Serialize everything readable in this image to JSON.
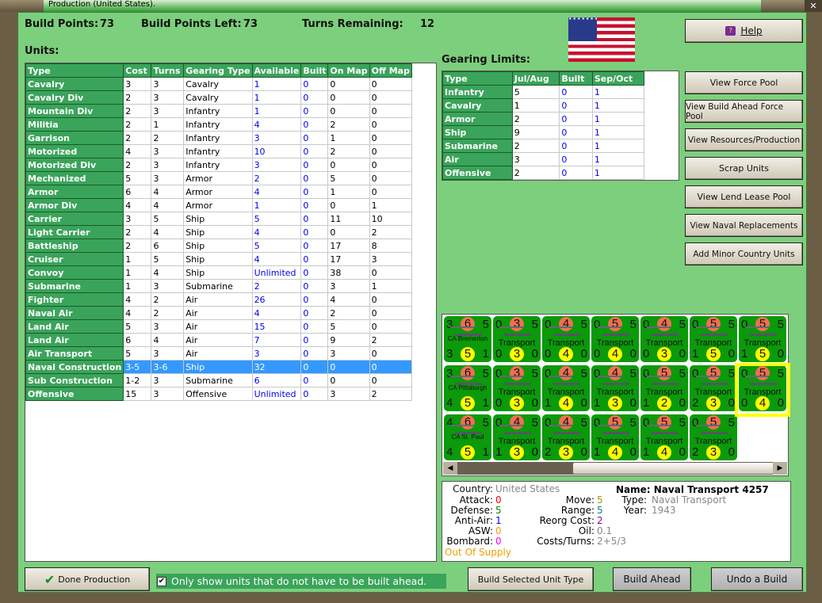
{
  "window": {
    "title": "Production (United States)."
  },
  "header": {
    "build_points_label": "Build Points:",
    "build_points": "73",
    "build_points_left_label": "Build Points Left:",
    "build_points_left": "73",
    "turns_remaining_label": "Turns Remaining:",
    "turns_remaining": "12"
  },
  "units": {
    "label": "Units:",
    "columns": [
      "Type",
      "Cost",
      "Turns",
      "Gearing Type",
      "Available",
      "Built",
      "On Map",
      "Off Map"
    ],
    "rows": [
      [
        "Cavalry",
        "3",
        "3",
        "Cavalry",
        "1",
        "0",
        "0",
        "0"
      ],
      [
        "Cavalry Div",
        "2",
        "3",
        "Cavalry",
        "1",
        "0",
        "0",
        "0"
      ],
      [
        "Mountain Div",
        "2",
        "3",
        "Infantry",
        "1",
        "0",
        "0",
        "0"
      ],
      [
        "Militia",
        "2",
        "1",
        "Infantry",
        "4",
        "0",
        "2",
        "0"
      ],
      [
        "Garrison",
        "2",
        "2",
        "Infantry",
        "3",
        "0",
        "1",
        "0"
      ],
      [
        "Motorized",
        "4",
        "3",
        "Infantry",
        "10",
        "0",
        "2",
        "0"
      ],
      [
        "Motorized Div",
        "2",
        "3",
        "Infantry",
        "3",
        "0",
        "0",
        "0"
      ],
      [
        "Mechanized",
        "5",
        "3",
        "Armor",
        "2",
        "0",
        "5",
        "0"
      ],
      [
        "Armor",
        "6",
        "4",
        "Armor",
        "4",
        "0",
        "1",
        "0"
      ],
      [
        "Armor Div",
        "4",
        "4",
        "Armor",
        "1",
        "0",
        "0",
        "1"
      ],
      [
        "Carrier",
        "3",
        "5",
        "Ship",
        "5",
        "0",
        "11",
        "10"
      ],
      [
        "Light Carrier",
        "2",
        "4",
        "Ship",
        "4",
        "0",
        "0",
        "2"
      ],
      [
        "Battleship",
        "2",
        "6",
        "Ship",
        "5",
        "0",
        "17",
        "8"
      ],
      [
        "Cruiser",
        "1",
        "5",
        "Ship",
        "4",
        "0",
        "17",
        "3"
      ],
      [
        "Convoy",
        "1",
        "4",
        "Ship",
        "Unlimited",
        "0",
        "38",
        "0"
      ],
      [
        "Submarine",
        "1",
        "3",
        "Submarine",
        "2",
        "0",
        "3",
        "1"
      ],
      [
        "Fighter",
        "4",
        "2",
        "Air",
        "26",
        "0",
        "4",
        "0"
      ],
      [
        "Naval Air",
        "4",
        "2",
        "Air",
        "4",
        "0",
        "2",
        "0"
      ],
      [
        "Land Air",
        "5",
        "3",
        "Air",
        "15",
        "0",
        "5",
        "0"
      ],
      [
        "Land Air",
        "6",
        "4",
        "Air",
        "7",
        "0",
        "9",
        "2"
      ],
      [
        "Air Transport",
        "5",
        "3",
        "Air",
        "3",
        "0",
        "3",
        "0"
      ],
      [
        "Naval Construction",
        "3-5",
        "3-6",
        "Ship",
        "32",
        "0",
        "0",
        "0"
      ],
      [
        "Sub Construction",
        "1-2",
        "3",
        "Submarine",
        "6",
        "0",
        "0",
        "0"
      ],
      [
        "Offensive",
        "15",
        "3",
        "Offensive",
        "Unlimited",
        "0",
        "3",
        "2"
      ]
    ],
    "selected_index": 21
  },
  "gearing": {
    "label": "Gearing Limits:",
    "columns": [
      "Type",
      "Jul/Aug",
      "Built",
      "Sep/Oct"
    ],
    "rows": [
      [
        "Infantry",
        "5",
        "0",
        "1"
      ],
      [
        "Cavalry",
        "1",
        "0",
        "1"
      ],
      [
        "Armor",
        "2",
        "0",
        "1"
      ],
      [
        "Ship",
        "9",
        "0",
        "1"
      ],
      [
        "Submarine",
        "2",
        "0",
        "1"
      ],
      [
        "Air",
        "3",
        "0",
        "1"
      ],
      [
        "Offensive",
        "2",
        "0",
        "1"
      ]
    ]
  },
  "buttons": {
    "help": "Help",
    "view_force_pool": "View Force Pool",
    "view_build_ahead": "View Build Ahead Force Pool",
    "view_resources": "View Resources/Production",
    "scrap_units": "Scrap Units",
    "view_lend_lease": "View Lend Lease Pool",
    "view_naval_replacements": "View Naval Replacements",
    "add_minor": "Add Minor Country Units",
    "done_production": "Done Production",
    "build_selected": "Build Selected Unit Type",
    "build_ahead": "Build Ahead",
    "undo_build": "Undo a Build"
  },
  "checkbox": {
    "label": "Only show units that do not have to be built ahead.",
    "checked": true
  },
  "counters": [
    [
      [
        3,
        6,
        5,
        "CA Bremerton",
        3,
        5,
        1
      ],
      [
        0,
        3,
        5,
        "Transport",
        0,
        3,
        0
      ],
      [
        0,
        4,
        5,
        "Transport",
        0,
        4,
        0
      ],
      [
        0,
        5,
        5,
        "Transport",
        0,
        4,
        0
      ],
      [
        0,
        4,
        5,
        "Transport",
        0,
        3,
        0
      ],
      [
        0,
        5,
        5,
        "Transport",
        1,
        5,
        0
      ],
      [
        0,
        5,
        5,
        "Transport",
        1,
        5,
        0
      ]
    ],
    [
      [
        3,
        6,
        5,
        "CA Pittsburgh",
        4,
        5,
        1
      ],
      [
        0,
        3,
        5,
        "Transport",
        0,
        3,
        0
      ],
      [
        0,
        4,
        5,
        "Transport",
        1,
        4,
        0
      ],
      [
        0,
        4,
        5,
        "Transport",
        1,
        3,
        0
      ],
      [
        0,
        5,
        5,
        "Transport",
        1,
        2,
        0
      ],
      [
        0,
        5,
        5,
        "Transport",
        2,
        3,
        0
      ],
      [
        0,
        5,
        5,
        "Transport",
        0,
        4,
        0
      ]
    ],
    [
      [
        4,
        6,
        5,
        "CA St. Paul",
        4,
        5,
        1
      ],
      [
        0,
        4,
        5,
        "Transport",
        1,
        3,
        0
      ],
      [
        0,
        4,
        5,
        "Transport",
        2,
        3,
        0
      ],
      [
        0,
        5,
        5,
        "Transport",
        1,
        4,
        0
      ],
      [
        0,
        5,
        5,
        "Transport",
        1,
        4,
        0
      ],
      [
        0,
        5,
        5,
        "Transport",
        2,
        3,
        0
      ]
    ]
  ],
  "info": {
    "country_label": "Country:",
    "country": "United States",
    "attack_label": "Attack:",
    "attack": "0",
    "defense_label": "Defense:",
    "defense": "5",
    "antiair_label": "Anti-Air:",
    "antiair": "1",
    "asw_label": "ASW:",
    "asw": "0",
    "bombard_label": "Bombard:",
    "bombard": "0",
    "supply": "Out Of Supply",
    "move_label": "Move:",
    "move": "5",
    "range_label": "Range:",
    "range": "5",
    "reorg_label": "Reorg Cost:",
    "reorg": "2",
    "oil_label": "Oil:",
    "oil": "0.1",
    "costs_label": "Costs/Turns:",
    "costs": "2+5/3",
    "name": "Name: Naval Transport 4257",
    "type_label": "Type:",
    "type": "Naval Transport",
    "year_label": "Year:",
    "year": "1943"
  },
  "colors": {
    "panel_green": "#7ccf7c",
    "header_green": "#3aa45a",
    "selection": "#3399ff",
    "highlight": "#ffff00"
  }
}
